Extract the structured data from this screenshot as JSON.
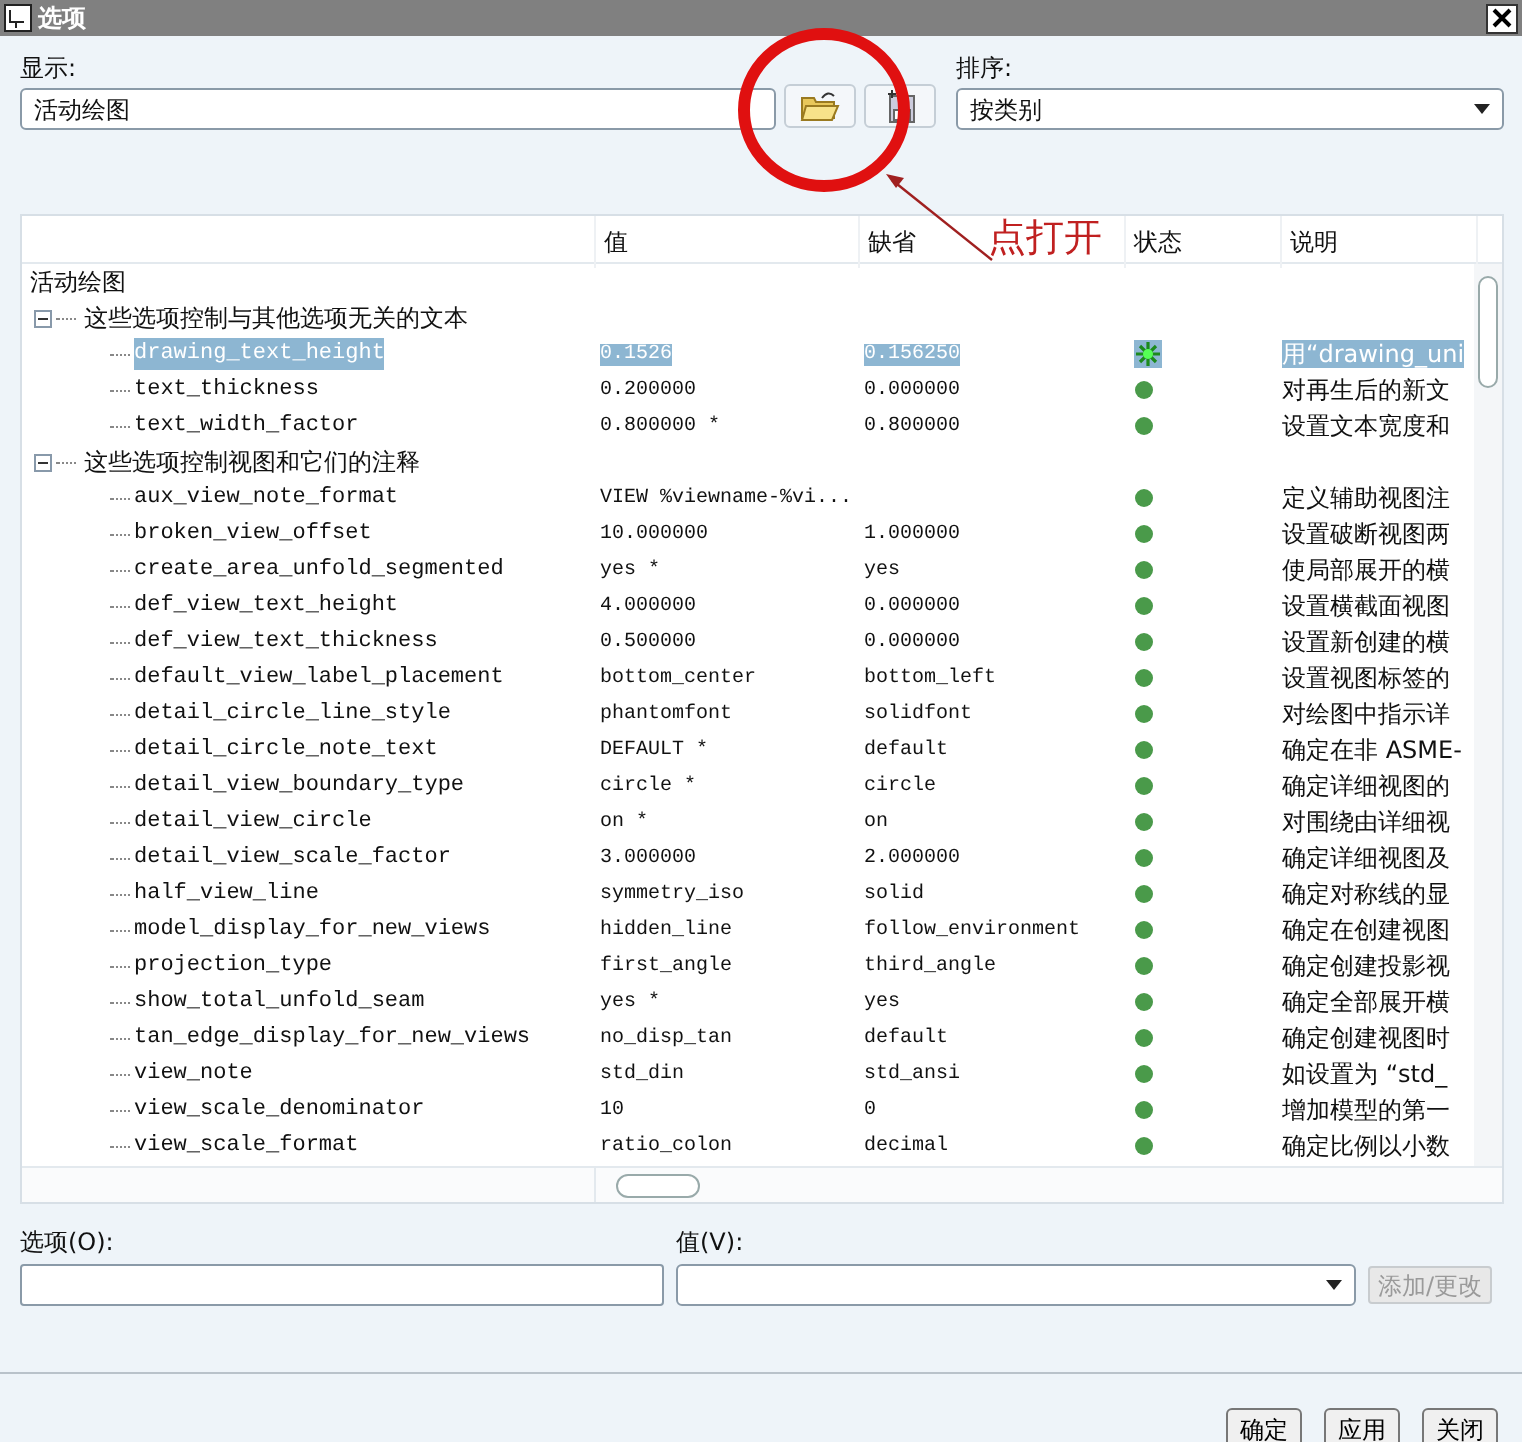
{
  "window": {
    "title": "选项"
  },
  "display": {
    "label": "显示:",
    "value": "活动绘图"
  },
  "sort": {
    "label": "排序:",
    "value": "按类别"
  },
  "annotation": {
    "text": "点打开"
  },
  "table": {
    "columns": [
      "值",
      "缺省",
      "状态",
      "说明"
    ],
    "tree": {
      "label": "活动绘图",
      "children": [
        {
          "label": "这些选项控制与其他选项无关的文本",
          "expanded": true,
          "children": [
            {
              "name": "drawing_text_height",
              "value": "0.1526",
              "default": "0.156250",
              "modified": true,
              "description": "用“drawing_uni",
              "selected": true
            },
            {
              "name": "text_thickness",
              "value": "0.200000",
              "default": "0.000000",
              "modified": false,
              "description": "对再生后的新文",
              "selected": false
            },
            {
              "name": "text_width_factor",
              "value": "0.800000 *",
              "default": "0.800000",
              "modified": false,
              "description": "设置文本宽度和",
              "selected": false
            }
          ]
        },
        {
          "label": "这些选项控制视图和它们的注释",
          "expanded": true,
          "children": [
            {
              "name": "aux_view_note_format",
              "value": "VIEW %viewname-%vi...",
              "modified": false,
              "description": "定义辅助视图注",
              "selected": false
            },
            {
              "name": "broken_view_offset",
              "value": "10.000000",
              "default": "1.000000",
              "modified": false,
              "description": "设置破断视图两",
              "selected": false
            },
            {
              "name": "create_area_unfold_segmented",
              "value": "yes *",
              "default": "yes",
              "modified": false,
              "description": "使局部展开的横",
              "selected": false
            },
            {
              "name": "def_view_text_height",
              "value": "4.000000",
              "default": "0.000000",
              "modified": false,
              "description": "设置横截面视图",
              "selected": false
            },
            {
              "name": "def_view_text_thickness",
              "value": "0.500000",
              "default": "0.000000",
              "modified": false,
              "description": "设置新创建的横",
              "selected": false
            },
            {
              "name": "default_view_label_placement",
              "value": "bottom_center",
              "default": "bottom_left",
              "modified": false,
              "description": "设置视图标签的",
              "selected": false
            },
            {
              "name": "detail_circle_line_style",
              "value": "phantomfont",
              "default": "solidfont",
              "modified": false,
              "description": "对绘图中指示详",
              "selected": false
            },
            {
              "name": "detail_circle_note_text",
              "value": "DEFAULT *",
              "default": "default",
              "modified": false,
              "description": "确定在非 ASME-",
              "selected": false
            },
            {
              "name": "detail_view_boundary_type",
              "value": "circle *",
              "default": "circle",
              "modified": false,
              "description": "确定详细视图的",
              "selected": false
            },
            {
              "name": "detail_view_circle",
              "value": "on *",
              "default": "on",
              "modified": false,
              "description": "对围绕由详细视",
              "selected": false
            },
            {
              "name": "detail_view_scale_factor",
              "value": "3.000000",
              "default": "2.000000",
              "modified": false,
              "description": "确定详细视图及",
              "selected": false
            },
            {
              "name": "half_view_line",
              "value": "symmetry_iso",
              "default": "solid",
              "modified": false,
              "description": "确定对称线的显",
              "selected": false
            },
            {
              "name": "model_display_for_new_views",
              "value": "hidden_line",
              "default": "follow_environment",
              "modified": false,
              "description": "确定在创建视图",
              "selected": false
            },
            {
              "name": "projection_type",
              "value": "first_angle",
              "default": "third_angle",
              "modified": false,
              "description": "确定创建投影视",
              "selected": false
            },
            {
              "name": "show_total_unfold_seam",
              "value": "yes *",
              "default": "yes",
              "modified": false,
              "description": "确定全部展开横",
              "selected": false
            },
            {
              "name": "tan_edge_display_for_new_views",
              "value": "no_disp_tan",
              "default": "default",
              "modified": false,
              "description": "确定创建视图时",
              "selected": false
            },
            {
              "name": "view_note",
              "value": "std_din",
              "default": "std_ansi",
              "modified": false,
              "description": "如设置为 “std_",
              "selected": false
            },
            {
              "name": "view_scale_denominator",
              "value": "10",
              "default": "0",
              "modified": false,
              "description": "增加模型的第一",
              "selected": false
            },
            {
              "name": "view_scale_format",
              "value": "ratio_colon",
              "default": "decimal",
              "modified": false,
              "description": "确定比例以小数",
              "selected": false
            }
          ]
        }
      ]
    }
  },
  "option_field": {
    "label": "选项(O):"
  },
  "value_field": {
    "label": "值(V):"
  },
  "add_button": {
    "label": "添加/更改",
    "disabled": true
  },
  "buttons": [
    "确定",
    "应用",
    "关闭"
  ]
}
